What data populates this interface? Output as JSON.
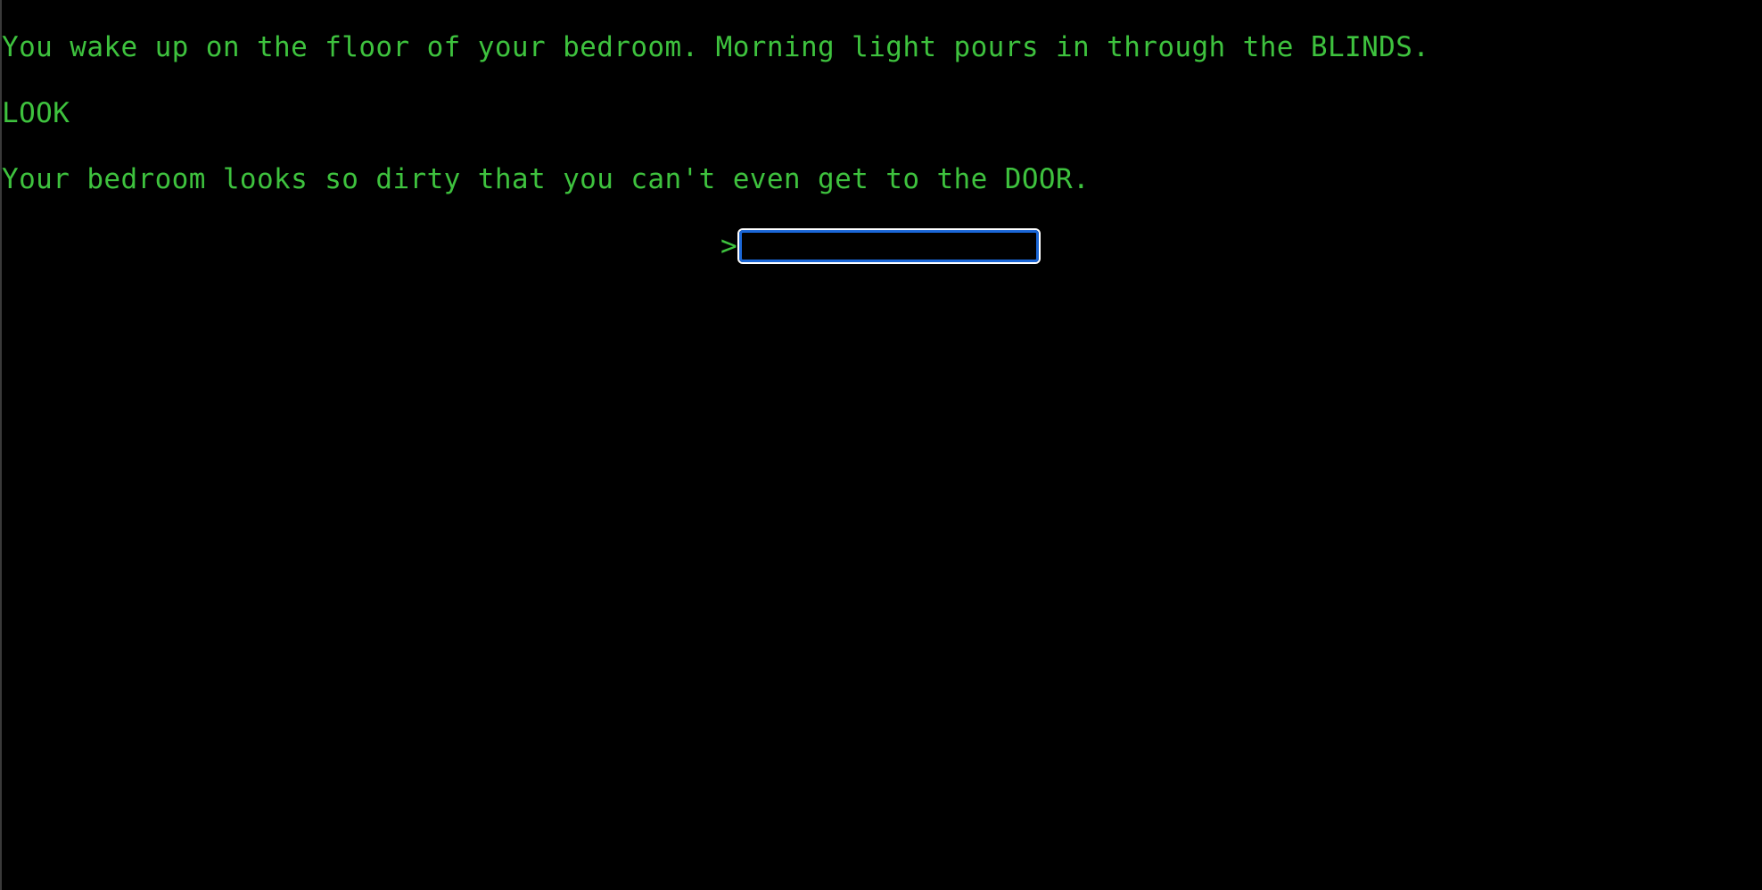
{
  "transcript": {
    "lines": [
      "You wake up on the floor of your bedroom. Morning light pours in through the BLINDS.",
      "LOOK",
      "Your bedroom looks so dirty that you can't even get to the DOOR."
    ]
  },
  "prompt": {
    "symbol": ">",
    "value": ""
  },
  "colors": {
    "background": "#000000",
    "text": "#3ec23e",
    "input_border": "#ffffff",
    "focus_ring": "#1a66d6"
  }
}
